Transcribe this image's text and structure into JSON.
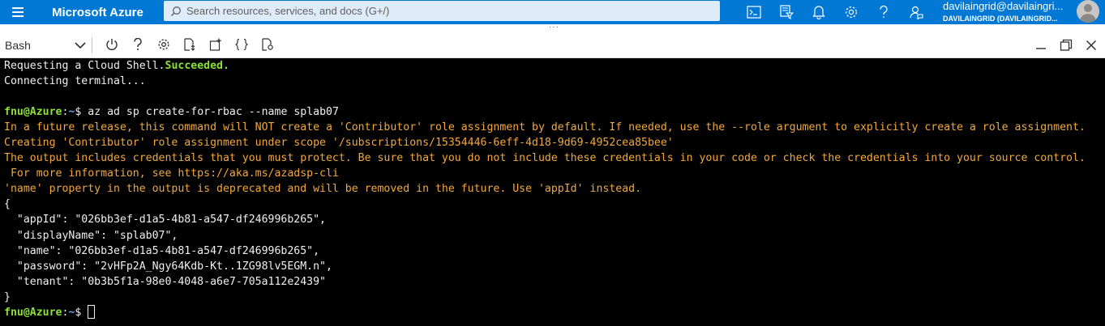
{
  "topbar": {
    "brand": "Microsoft Azure",
    "search_placeholder": "Search resources, services, and docs (G+/)",
    "icons": [
      "cloud-shell-icon",
      "directory-filter-icon",
      "bell-icon",
      "gear-icon",
      "help-icon",
      "feedback-icon"
    ],
    "account_email": "davilaingrid@davilaingri...",
    "account_directory": "DAVILAINGRID (DAVILAINGRID...",
    "bg_color": "#0078d4"
  },
  "shellbar": {
    "shell_type": "Bash",
    "drag_handle": "···",
    "tool_icons": [
      "power-icon",
      "help-icon",
      "settings-icon",
      "upload-download-icon",
      "open-new-session-icon",
      "editor-braces-icon",
      "web-preview-icon"
    ],
    "window_controls": [
      "minimize-icon",
      "maximize-icon",
      "close-icon"
    ]
  },
  "terminal": {
    "colors": {
      "text": "#f0f0f0",
      "success": "#8ae234",
      "warning": "#f2a83a",
      "prompt_path": "#6aa0e6"
    },
    "lines": [
      {
        "parts": [
          {
            "text": "Requesting a Cloud Shell.",
            "style": "white"
          },
          {
            "text": "Succeeded.",
            "style": "green"
          }
        ]
      },
      {
        "parts": [
          {
            "text": "Connecting terminal...",
            "style": "white"
          }
        ]
      },
      {
        "parts": [
          {
            "text": "",
            "style": "white"
          }
        ]
      },
      {
        "parts": [
          {
            "text": "fnu@Azure",
            "style": "green"
          },
          {
            "text": ":",
            "style": "white"
          },
          {
            "text": "~",
            "style": "blue"
          },
          {
            "text": "$ az ad sp create-for-rbac --name splab07",
            "style": "white"
          }
        ]
      },
      {
        "parts": [
          {
            "text": "In a future release, this command will NOT create a 'Contributor' role assignment by default. If needed, use the --role argument to explicitly create a role assignment.",
            "style": "orange"
          }
        ]
      },
      {
        "parts": [
          {
            "text": "Creating 'Contributor' role assignment under scope '/subscriptions/15354446-6eff-4d18-9d69-4952cea85bee'",
            "style": "orange"
          }
        ]
      },
      {
        "parts": [
          {
            "text": "The output includes credentials that you must protect. Be sure that you do not include these credentials in your code or check the credentials into your source control.",
            "style": "orange"
          }
        ]
      },
      {
        "parts": [
          {
            "text": " For more information, see https://aka.ms/azadsp-cli",
            "style": "orange"
          }
        ]
      },
      {
        "parts": [
          {
            "text": "'name' property in the output is deprecated and will be removed in the future. Use 'appId' instead.",
            "style": "orange"
          }
        ]
      },
      {
        "parts": [
          {
            "text": "{",
            "style": "white"
          }
        ]
      },
      {
        "parts": [
          {
            "text": "  \"appId\": \"026bb3ef-d1a5-4b81-a547-df246996b265\",",
            "style": "white"
          }
        ]
      },
      {
        "parts": [
          {
            "text": "  \"displayName\": \"splab07\",",
            "style": "white"
          }
        ]
      },
      {
        "parts": [
          {
            "text": "  \"name\": \"026bb3ef-d1a5-4b81-a547-df246996b265\",",
            "style": "white"
          }
        ]
      },
      {
        "parts": [
          {
            "text": "  \"password\": \"2vHFp2A_Ngy64Kdb-Kt..1ZG98lv5EGM.n\",",
            "style": "white"
          }
        ]
      },
      {
        "parts": [
          {
            "text": "  \"tenant\": \"0b3b5f1a-98e0-4048-a6e7-705a112e2439\"",
            "style": "white"
          }
        ]
      },
      {
        "parts": [
          {
            "text": "}",
            "style": "white"
          }
        ]
      },
      {
        "parts": [
          {
            "text": "fnu@Azure",
            "style": "green"
          },
          {
            "text": ":",
            "style": "white"
          },
          {
            "text": "~",
            "style": "blue"
          },
          {
            "text": "$ ",
            "style": "white"
          }
        ],
        "cursor": true
      }
    ]
  }
}
